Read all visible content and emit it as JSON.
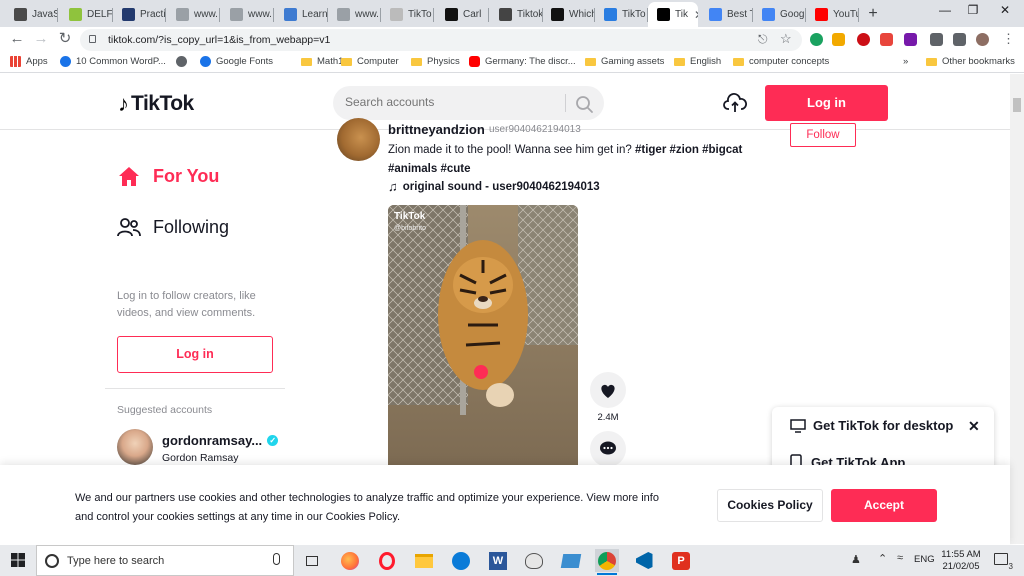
{
  "browser": {
    "tabs": [
      {
        "label": "JavaS",
        "favicon_color": "#4a4a4a"
      },
      {
        "label": "DELF",
        "favicon_color": "#8fc33d"
      },
      {
        "label": "Practi",
        "favicon_color": "#233a6e"
      },
      {
        "label": "www.",
        "favicon_color": "#9aa0a6"
      },
      {
        "label": "www.",
        "favicon_color": "#9aa0a6"
      },
      {
        "label": "Learn",
        "favicon_color": "#3e7bd1"
      },
      {
        "label": "www.",
        "favicon_color": "#9aa0a6"
      },
      {
        "label": "TikTo",
        "favicon_color": "#bbbbbb"
      },
      {
        "label": "Carl",
        "favicon_color": "#111111"
      },
      {
        "label": "Tiktok",
        "favicon_color": "#444444"
      },
      {
        "label": "Which",
        "favicon_color": "#111111"
      },
      {
        "label": "TikTo",
        "favicon_color": "#2a7de1"
      },
      {
        "label": "Tik",
        "favicon_color": "#010101",
        "active": true
      },
      {
        "label": "Best T",
        "favicon_color": "#4285f4"
      },
      {
        "label": "Goog",
        "favicon_color": "#4285f4"
      },
      {
        "label": "YouTu",
        "favicon_color": "#ff0000"
      }
    ],
    "new_tab": "+",
    "url": "tiktok.com/?is_copy_url=1&is_from_webapp=v1",
    "bookmarks": [
      {
        "label": "Apps",
        "kind": "apps"
      },
      {
        "label": "10 Common WordP...",
        "kind": "site"
      },
      {
        "label": "",
        "kind": "globe"
      },
      {
        "label": "Google Fonts",
        "kind": "site"
      },
      {
        "label": "Math1",
        "kind": "folder"
      },
      {
        "label": "Computer",
        "kind": "folder"
      },
      {
        "label": "Physics",
        "kind": "folder"
      },
      {
        "label": "Germany: The discr...",
        "kind": "youtube"
      },
      {
        "label": "Gaming assets",
        "kind": "folder"
      },
      {
        "label": "English",
        "kind": "folder"
      },
      {
        "label": "computer concepts",
        "kind": "folder"
      }
    ],
    "bookmarks_more": "»",
    "other_bookmarks": "Other bookmarks"
  },
  "tiktok": {
    "logo_text": "TikTok",
    "search_placeholder": "Search accounts",
    "login_button": "Log in",
    "nav": {
      "for_you": "For You",
      "following": "Following"
    },
    "login_hint": "Log in to follow creators, like videos, and view comments.",
    "sidebar_login": "Log in",
    "suggested_title": "Suggested accounts",
    "suggested": {
      "name": "gordonramsay...",
      "subtitle": "Gordon Ramsay"
    },
    "post": {
      "username": "brittneyandzion",
      "nickname": "user9040462194013",
      "caption_text": "Zion made it to the pool! Wanna see him get in?",
      "hashtags": [
        "#tiger",
        "#zion",
        "#bigcat",
        "#animals",
        "#cute"
      ],
      "sound": "original sound - user9040462194013",
      "follow": "Follow",
      "watermark": "TikTok",
      "watermark_user": "@bitobrito",
      "likes": "2.4M"
    },
    "desktop_popup": {
      "desktop": "Get TikTok for desktop",
      "app": "Get TikTok App"
    },
    "cookie": {
      "text": "We and our partners use cookies and other technologies to analyze traffic and optimize your experience. View more info and control your cookies settings at any time in our Cookies Policy.",
      "policy_button": "Cookies Policy",
      "accept_button": "Accept"
    },
    "colors": {
      "brand_red": "#fe2c55",
      "text_dark": "#161823",
      "muted": "#8a8b91"
    }
  },
  "taskbar": {
    "search_placeholder": "Type here to search",
    "language": "ENG",
    "time": "11:55 AM",
    "date": "21/02/05",
    "notifications": "3"
  }
}
